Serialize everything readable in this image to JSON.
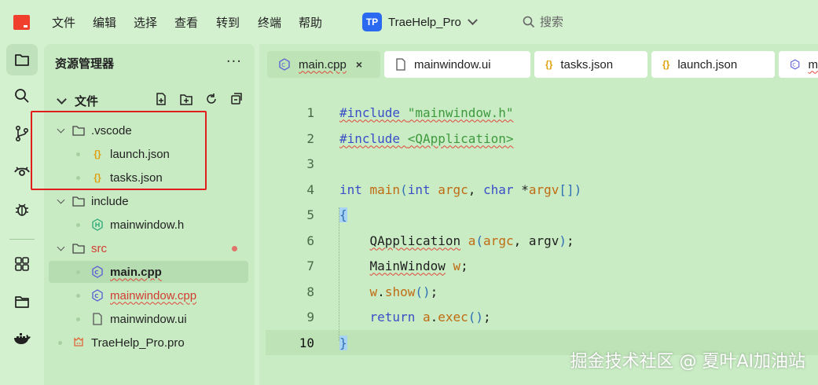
{
  "menu": {
    "items": [
      "文件",
      "编辑",
      "选择",
      "查看",
      "转到",
      "终端",
      "帮助"
    ]
  },
  "project": {
    "badge": "TP",
    "name": "TraeHelp_Pro"
  },
  "search": {
    "label": "搜索"
  },
  "activity": {
    "icons": [
      "files-icon",
      "search-icon",
      "source-control-icon",
      "eye-icon",
      "debug-icon",
      "extensions-icon",
      "folder-icon",
      "docker-icon"
    ],
    "active_index": 0
  },
  "explorer": {
    "title": "资源管理器",
    "more": "···",
    "section": "文件",
    "tree": [
      {
        "label": ".vscode",
        "type": "folder",
        "depth": 0
      },
      {
        "label": "launch.json",
        "type": "json",
        "depth": 1
      },
      {
        "label": "tasks.json",
        "type": "json",
        "depth": 1
      },
      {
        "label": "include",
        "type": "folder",
        "depth": 0
      },
      {
        "label": "mainwindow.h",
        "type": "header",
        "depth": 1
      },
      {
        "label": "src",
        "type": "folder",
        "depth": 0,
        "modified": true
      },
      {
        "label": "main.cpp",
        "type": "cpp",
        "depth": 1,
        "selected": true
      },
      {
        "label": "mainwindow.cpp",
        "type": "cpp",
        "depth": 1,
        "error": true
      },
      {
        "label": "mainwindow.ui",
        "type": "file",
        "depth": 1
      },
      {
        "label": "TraeHelp_Pro.pro",
        "type": "pro",
        "depth": 0
      }
    ]
  },
  "tabs": [
    {
      "label": "main.cpp",
      "icon": "cpp-icon",
      "active": true,
      "close": "×"
    },
    {
      "label": "mainwindow.ui",
      "icon": "file-icon"
    },
    {
      "label": "tasks.json",
      "icon": "json-icon"
    },
    {
      "label": "launch.json",
      "icon": "json-icon"
    },
    {
      "label": "m",
      "icon": "cpp-icon"
    }
  ],
  "code": {
    "current_line": 10,
    "lines": [
      {
        "n": "1",
        "text": "#include \"mainwindow.h\""
      },
      {
        "n": "2",
        "text": "#include <QApplication>"
      },
      {
        "n": "3",
        "text": ""
      },
      {
        "n": "4",
        "text": "int main(int argc, char *argv[])"
      },
      {
        "n": "5",
        "text": "{"
      },
      {
        "n": "6",
        "text": "    QApplication a(argc, argv);"
      },
      {
        "n": "7",
        "text": "    MainWindow w;"
      },
      {
        "n": "8",
        "text": "    w.show();"
      },
      {
        "n": "9",
        "text": "    return a.exec();"
      },
      {
        "n": "10",
        "text": "}"
      }
    ]
  },
  "watermark": "掘金技术社区 @ 夏叶AI加油站",
  "colors": {
    "background": "#d3f0cf",
    "accent": "#2b69f0",
    "logo": "#f0402d",
    "highlight_box": "#e11d1d"
  }
}
